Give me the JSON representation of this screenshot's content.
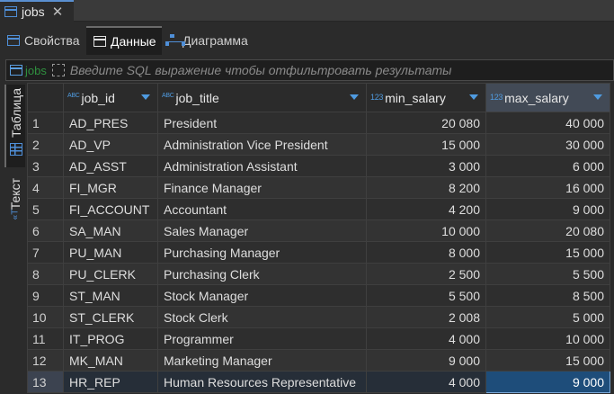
{
  "editor_tab": {
    "title": "jobs",
    "close": "✕"
  },
  "subtabs": [
    {
      "label": "Свойства"
    },
    {
      "label": "Данные"
    },
    {
      "label": "Диаграмма"
    }
  ],
  "filter": {
    "table_name": "jobs",
    "placeholder": "Введите SQL выражение чтобы отфильтровать результаты"
  },
  "side_tabs": {
    "table": "Таблица",
    "text": "Текст",
    "text_icon": "«T"
  },
  "grid": {
    "columns": [
      {
        "label": "job_id",
        "type": "ABC"
      },
      {
        "label": "job_title",
        "type": "ABC"
      },
      {
        "label": "min_salary",
        "type": "123"
      },
      {
        "label": "max_salary",
        "type": "123"
      }
    ],
    "rows": [
      {
        "n": "1",
        "job_id": "AD_PRES",
        "job_title": "President",
        "min": "20 080",
        "max": "40 000"
      },
      {
        "n": "2",
        "job_id": "AD_VP",
        "job_title": "Administration Vice President",
        "min": "15 000",
        "max": "30 000"
      },
      {
        "n": "3",
        "job_id": "AD_ASST",
        "job_title": "Administration Assistant",
        "min": "3 000",
        "max": "6 000"
      },
      {
        "n": "4",
        "job_id": "FI_MGR",
        "job_title": "Finance Manager",
        "min": "8 200",
        "max": "16 000"
      },
      {
        "n": "5",
        "job_id": "FI_ACCOUNT",
        "job_title": "Accountant",
        "min": "4 200",
        "max": "9 000"
      },
      {
        "n": "6",
        "job_id": "SA_MAN",
        "job_title": "Sales Manager",
        "min": "10 000",
        "max": "20 080"
      },
      {
        "n": "7",
        "job_id": "PU_MAN",
        "job_title": "Purchasing Manager",
        "min": "8 000",
        "max": "15 000"
      },
      {
        "n": "8",
        "job_id": "PU_CLERK",
        "job_title": "Purchasing Clerk",
        "min": "2 500",
        "max": "5 500"
      },
      {
        "n": "9",
        "job_id": "ST_MAN",
        "job_title": "Stock Manager",
        "min": "5 500",
        "max": "8 500"
      },
      {
        "n": "10",
        "job_id": "ST_CLERK",
        "job_title": "Stock Clerk",
        "min": "2 008",
        "max": "5 000"
      },
      {
        "n": "11",
        "job_id": "IT_PROG",
        "job_title": "Programmer",
        "min": "4 000",
        "max": "10 000"
      },
      {
        "n": "12",
        "job_id": "MK_MAN",
        "job_title": "Marketing Manager",
        "min": "9 000",
        "max": "15 000"
      },
      {
        "n": "13",
        "job_id": "HR_REP",
        "job_title": "Human Resources Representative",
        "min": "4 000",
        "max": "9 000"
      }
    ]
  },
  "colors": {
    "accent": "#4f8fd8",
    "selection": "#1e4d7a",
    "filter_name": "#2f8f3f"
  }
}
